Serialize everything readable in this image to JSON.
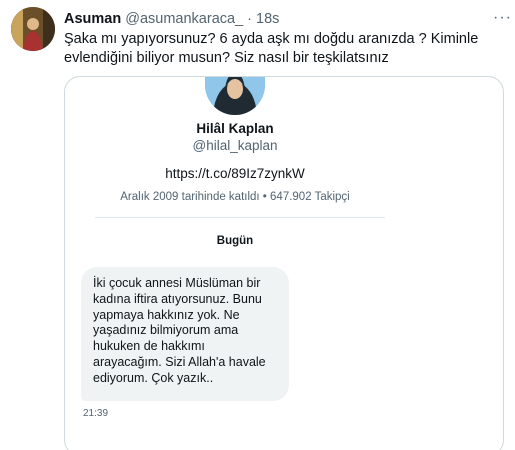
{
  "tweet": {
    "display_name": "Asuman",
    "handle": "@asumankaraca_",
    "separator": "·",
    "time": "18s",
    "text": "Şaka mı yapıyorsunuz? 6 ayda aşk mı doğdu aranızda ? Kiminle evlendiğini biliyor musun? Siz nasıl bir teşkilatsınız",
    "more_icon": "more-horizontal-icon"
  },
  "screenshot": {
    "profile": {
      "name": "Hilâl Kaplan",
      "handle": "@hilal_kaplan",
      "link": "https://t.co/89Iz7zynkW",
      "meta": "Aralık 2009 tarihinde katıldı • 647.902 Takipçi"
    },
    "day_label": "Bugün",
    "message": {
      "lines": [
        "İki çocuk annesi Müslüman bir",
        "kadına iftira atıyorsunuz. Bunu",
        "yapmaya hakkınız yok. Ne",
        "yaşadınız bilmiyorum ama",
        "hukuken de hakkımı",
        "arayacağım. Sizi Allah'a havale",
        "ediyorum. Çok yazık.."
      ],
      "time": "21:39"
    }
  }
}
